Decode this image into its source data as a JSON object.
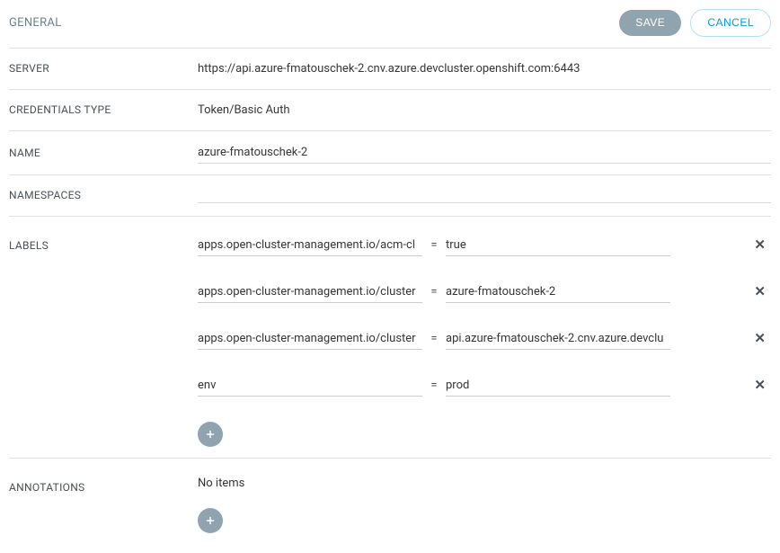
{
  "section": {
    "title": "GENERAL"
  },
  "actions": {
    "save": "SAVE",
    "cancel": "CANCEL"
  },
  "fields": {
    "server": {
      "label": "SERVER",
      "value": "https://api.azure-fmatouschek-2.cnv.azure.devcluster.openshift.com:6443"
    },
    "credentials_type": {
      "label": "CREDENTIALS TYPE",
      "value": "Token/Basic Auth"
    },
    "name": {
      "label": "NAME",
      "value": "azure-fmatouschek-2"
    },
    "namespaces": {
      "label": "NAMESPACES",
      "value": ""
    },
    "labels": {
      "label": "LABELS",
      "eq": "=",
      "items": [
        {
          "key": "apps.open-cluster-management.io/acm-cl",
          "value": "true"
        },
        {
          "key": "apps.open-cluster-management.io/cluster",
          "value": "azure-fmatouschek-2"
        },
        {
          "key": "apps.open-cluster-management.io/cluster",
          "value": "api.azure-fmatouschek-2.cnv.azure.devclu"
        },
        {
          "key": "env",
          "value": "prod"
        }
      ]
    },
    "annotations": {
      "label": "ANNOTATIONS",
      "empty": "No items"
    }
  }
}
